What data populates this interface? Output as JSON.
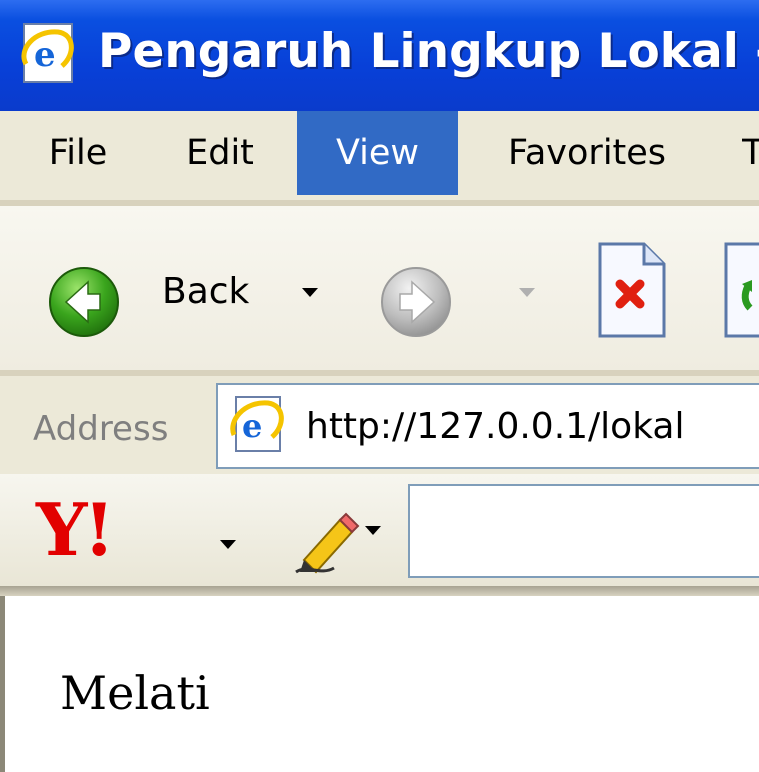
{
  "window": {
    "title": "Pengaruh Lingkup Lokal -",
    "icon": "ie-page-icon"
  },
  "menu": {
    "items": [
      {
        "label": "File"
      },
      {
        "label": "Edit"
      },
      {
        "label": "View",
        "active": true
      },
      {
        "label": "Favorites"
      },
      {
        "label": "T"
      }
    ]
  },
  "toolbar": {
    "back_label": "Back",
    "icons": [
      "back-arrow-icon",
      "forward-arrow-icon",
      "stop-icon",
      "refresh-icon"
    ]
  },
  "address": {
    "label": "Address",
    "url": "http://127.0.0.1/lokal"
  },
  "yahoo_toolbar": {
    "logo": "Y!",
    "icons": [
      "yahoo-logo-icon",
      "pencil-icon"
    ]
  },
  "page": {
    "text": "Melati"
  },
  "colors": {
    "titlebar": "#0a4fe0",
    "menu_active": "#316ac5",
    "chrome": "#ece9d8"
  }
}
